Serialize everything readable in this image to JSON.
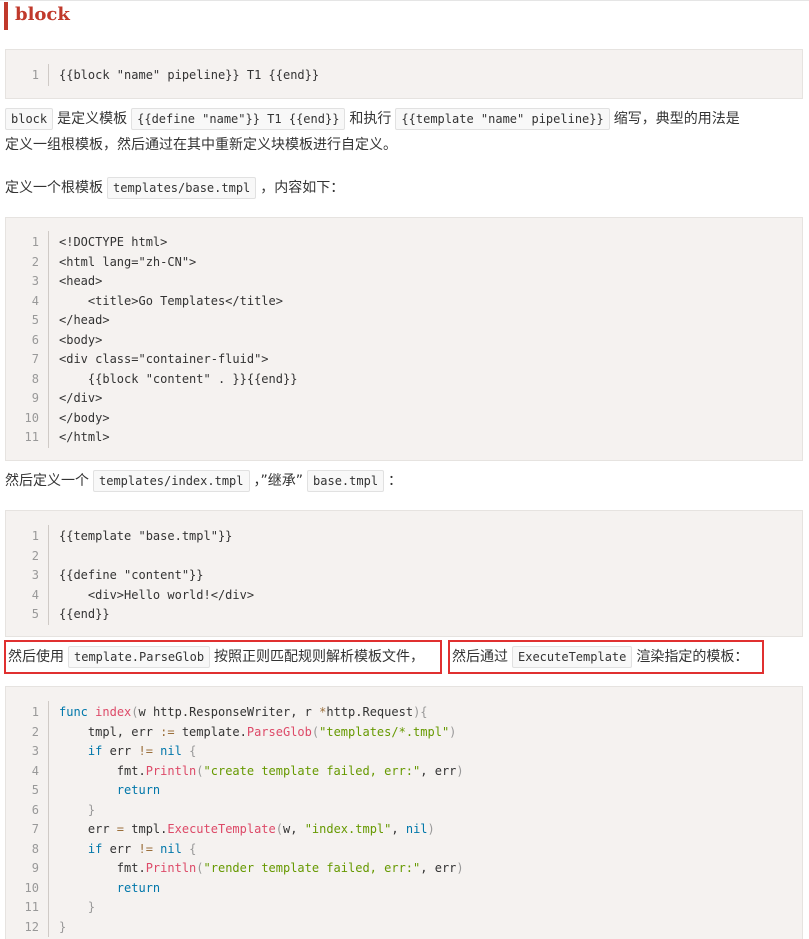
{
  "heading": "block",
  "code1": [
    {
      "n": "1",
      "t": "{{block \"name\" pipeline}} T1 {{end}}"
    }
  ],
  "para1": {
    "c1": "block",
    "t1": "是定义模板",
    "c2": "{{define \"name\"}} T1 {{end}}",
    "t2": "和执行",
    "c3": "{{template \"name\" pipeline}}",
    "t3": "缩写，典型的用法是",
    "t4": "定义一组根模板，然后通过在其中重新定义块模板进行自定义。"
  },
  "para2": {
    "t1": "定义一个根模板",
    "c1": "templates/base.tmpl",
    "t2": "，内容如下："
  },
  "code2": [
    {
      "n": "1",
      "t": "<!DOCTYPE html>"
    },
    {
      "n": "2",
      "t": "<html lang=\"zh-CN\">"
    },
    {
      "n": "3",
      "t": "<head>"
    },
    {
      "n": "4",
      "t": "    <title>Go Templates</title>"
    },
    {
      "n": "5",
      "t": "</head>"
    },
    {
      "n": "6",
      "t": "<body>"
    },
    {
      "n": "7",
      "t": "<div class=\"container-fluid\">"
    },
    {
      "n": "8",
      "t": "    {{block \"content\" . }}{{end}}"
    },
    {
      "n": "9",
      "t": "</div>"
    },
    {
      "n": "10",
      "t": "</body>"
    },
    {
      "n": "11",
      "t": "</html>"
    }
  ],
  "para3": {
    "t1": "然后定义一个",
    "c1": "templates/index.tmpl",
    "t2": "，”继承”",
    "c2": "base.tmpl",
    "t3": "："
  },
  "code3": [
    {
      "n": "1",
      "t": "{{template \"base.tmpl\"}}"
    },
    {
      "n": "2",
      "t": ""
    },
    {
      "n": "3",
      "t": "{{define \"content\"}}"
    },
    {
      "n": "4",
      "t": "    <div>Hello world!</div>"
    },
    {
      "n": "5",
      "t": "{{end}}"
    }
  ],
  "para4": {
    "a_t1": "然后使用",
    "a_c1": "template.ParseGlob",
    "a_t2": "按照正则匹配规则解析模板文件，",
    "b_t1": "然后通过",
    "b_c1": "ExecuteTemplate",
    "b_t2": "渲染指定的模板："
  },
  "code4": [
    {
      "n": "1",
      "t": "func index(w http.ResponseWriter, r *http.Request){"
    },
    {
      "n": "2",
      "t": "    tmpl, err := template.ParseGlob(\"templates/*.tmpl\")"
    },
    {
      "n": "3",
      "t": "    if err != nil {"
    },
    {
      "n": "4",
      "t": "        fmt.Println(\"create template failed, err:\", err)"
    },
    {
      "n": "5",
      "t": "        return"
    },
    {
      "n": "6",
      "t": "    }"
    },
    {
      "n": "7",
      "t": "    err = tmpl.ExecuteTemplate(w, \"index.tmpl\", nil)"
    },
    {
      "n": "8",
      "t": "    if err != nil {"
    },
    {
      "n": "9",
      "t": "        fmt.Println(\"render template failed, err:\", err)"
    },
    {
      "n": "10",
      "t": "        return"
    },
    {
      "n": "11",
      "t": "    }"
    },
    {
      "n": "12",
      "t": "}"
    }
  ],
  "colors": {
    "accent": "#c0392b",
    "highlight_box": "#e03030",
    "code_bg": "#f5f2f0",
    "keyword": "#0077aa",
    "function": "#dd4a68",
    "string": "#669900"
  }
}
